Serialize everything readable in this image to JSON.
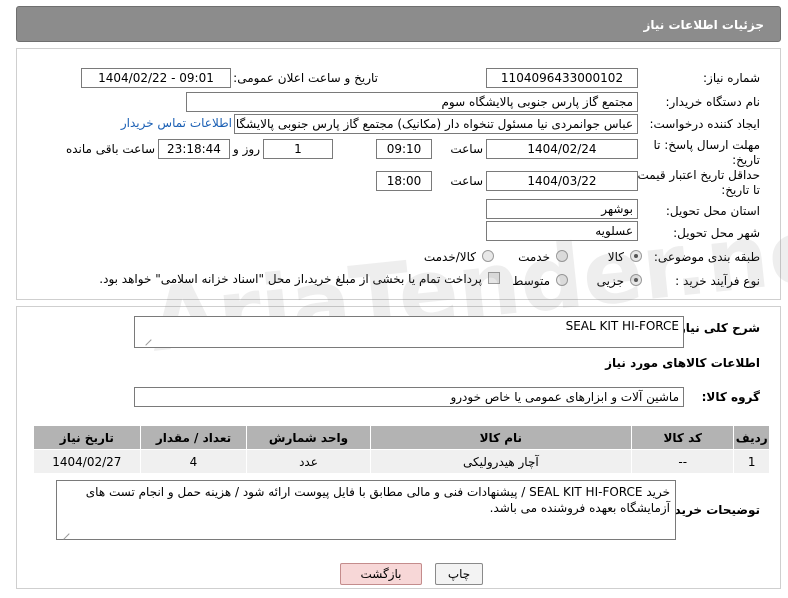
{
  "header": {
    "title": "جزئیات اطلاعات نیاز"
  },
  "form": {
    "need_number_label": "شماره نیاز:",
    "need_number": "1104096433000102",
    "announce_label": "تاریخ و ساعت اعلان عمومی:",
    "announce_value": "1404/02/22 - 09:01",
    "buyer_org_label": "نام دستگاه خریدار:",
    "buyer_org": "مجتمع گاز پارس جنوبی  پالایشگاه سوم",
    "creator_label": "ایجاد کننده درخواست:",
    "creator": "عباس جوانمردی نیا مسئول تنخواه دار  (مکانیک) مجتمع گاز پارس جنوبی  پالایشگاه سوم",
    "buyer_contact_link": "اطلاعات تماس خریدار",
    "deadline_label_1": "مهلت ارسال پاسخ: تا",
    "deadline_label_2": "تاریخ:",
    "deadline_date": "1404/02/24",
    "time_label": "ساعت",
    "deadline_time": "09:10",
    "days_value": "1",
    "days_label": "روز و",
    "remaining_time": "23:18:44",
    "remaining_label": "ساعت باقی مانده",
    "price_label_1": "حداقل تاریخ اعتبار قیمت:",
    "price_label_2": "تا تاریخ:",
    "price_date": "1404/03/22",
    "price_time_label": "ساعت",
    "price_time": "18:00",
    "province_label": "استان محل تحویل:",
    "province": "بوشهر",
    "city_label": "شهر محل تحویل:",
    "city": "عسلویه",
    "category_label": "طبقه بندی موضوعی:",
    "category_options": [
      "کالا",
      "خدمت",
      "کالا/خدمت"
    ],
    "process_label": "نوع فرآیند خرید :",
    "process_options": [
      "جزیی",
      "متوسط"
    ],
    "payment_note": "پرداخت تمام یا بخشی از مبلغ خرید،از محل \"اسناد خزانه اسلامی\" خواهد بود."
  },
  "details": {
    "desc_label": "شرح کلی نیاز:",
    "desc_value": "SEAL KIT HI-FORCE",
    "goods_info_title": "اطلاعات کالاهای مورد نیاز",
    "goods_group_label": "گروه کالا:",
    "goods_group": "ماشین آلات و ابزارهای عمومی یا خاص خودرو",
    "table": {
      "headers": [
        "ردیف",
        "کد کالا",
        "نام کالا",
        "واحد شمارش",
        "تعداد / مقدار",
        "تاریخ نیاز"
      ],
      "rows": [
        [
          "1",
          "--",
          "آچار هیدرولیکی",
          "عدد",
          "4",
          "1404/02/27"
        ]
      ]
    },
    "buyer_notes_label": "توضیحات خریدار:",
    "buyer_notes": "خرید SEAL KIT HI-FORCE / پیشنهادات فنی و مالی مطابق با فایل پیوست ارائه شود / هزینه حمل و انجام تست های آزمایشگاه بعهده فروشنده می باشد."
  },
  "buttons": {
    "print": "چاپ",
    "back": "بازگشت"
  },
  "watermark": "AriaTender.net"
}
